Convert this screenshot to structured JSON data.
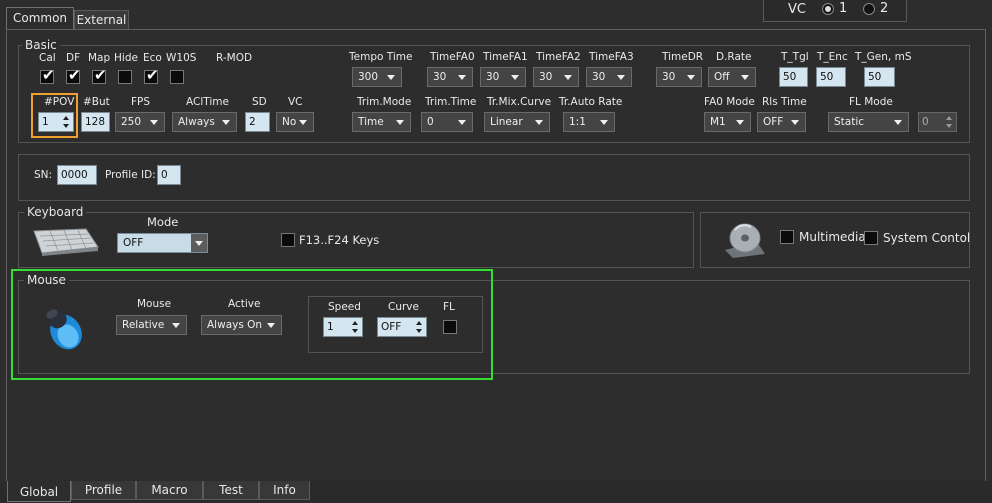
{
  "top_tabs": [
    "Common",
    "External"
  ],
  "vc": {
    "label": "VC",
    "opt1": "1",
    "opt2": "2"
  },
  "basic": {
    "title": "Basic",
    "checks": [
      {
        "label": "Cal",
        "checked": true
      },
      {
        "label": "DF",
        "checked": true
      },
      {
        "label": "Map",
        "checked": true
      },
      {
        "label": "Hide",
        "checked": false
      },
      {
        "label": "Eco",
        "checked": true
      },
      {
        "label": "W10S",
        "checked": false
      }
    ],
    "rmod": "R-MOD",
    "row1": {
      "tempo_time": {
        "label": "Tempo Time",
        "value": "300"
      },
      "timefa0": {
        "label": "TimeFA0",
        "value": "30"
      },
      "timefa1": {
        "label": "TimeFA1",
        "value": "30"
      },
      "timefa2": {
        "label": "TimeFA2",
        "value": "30"
      },
      "timefa3": {
        "label": "TimeFA3",
        "value": "30"
      },
      "timedr": {
        "label": "TimeDR",
        "value": "30"
      },
      "drate": {
        "label": "D.Rate",
        "value": "Off"
      },
      "t_tgl": {
        "label": "T_Tgl",
        "value": "50"
      },
      "t_enc": {
        "label": "T_Enc",
        "value": "50"
      },
      "t_gen": {
        "label": "T_Gen, mS",
        "value": "50"
      }
    },
    "row2": {
      "pov": {
        "label": "#POV",
        "value": "1"
      },
      "but": {
        "label": "#But",
        "value": "128"
      },
      "fps": {
        "label": "FPS",
        "value": "250"
      },
      "acltime": {
        "label": "AClTime",
        "value": "Always"
      },
      "sd": {
        "label": "SD",
        "value": "2"
      },
      "vc": {
        "label": "VC",
        "value": "No"
      },
      "trim_mode": {
        "label": "Trim.Mode",
        "value": "Time"
      },
      "trim_time": {
        "label": "Trim.Time",
        "value": "0"
      },
      "mix_curve": {
        "label": "Tr.Mix.Curve",
        "value": "Linear"
      },
      "auto_rate": {
        "label": "Tr.Auto Rate",
        "value": "1:1"
      },
      "fa0_mode": {
        "label": "FA0 Mode",
        "value": "M1"
      },
      "rls_time": {
        "label": "Rls Time",
        "value": "OFF"
      },
      "fl_mode": {
        "label": "FL Mode",
        "value": "Static"
      },
      "fl_value": "0"
    }
  },
  "ids": {
    "sn_label": "SN:",
    "sn_value": "0000",
    "profile_label": "Profile ID:",
    "profile_value": "0"
  },
  "keyboard": {
    "title": "Keyboard",
    "mode_label": "Mode",
    "mode_value": "OFF",
    "f13": "F13..F24 Keys"
  },
  "media": {
    "multimedia": "Multimedia",
    "system": "System Contol"
  },
  "mouse": {
    "title": "Mouse",
    "mouse_label": "Mouse",
    "mouse_value": "Relative",
    "active_label": "Active",
    "active_value": "Always On",
    "speed_label": "Speed",
    "speed_value": "1",
    "curve_label": "Curve",
    "curve_value": "OFF",
    "fl_label": "FL"
  },
  "bottom_tabs": [
    "Global",
    "Profile",
    "Macro",
    "Test",
    "Info"
  ],
  "colors": {
    "highlight_orange": "#f0a030",
    "highlight_green": "#33dd33"
  }
}
